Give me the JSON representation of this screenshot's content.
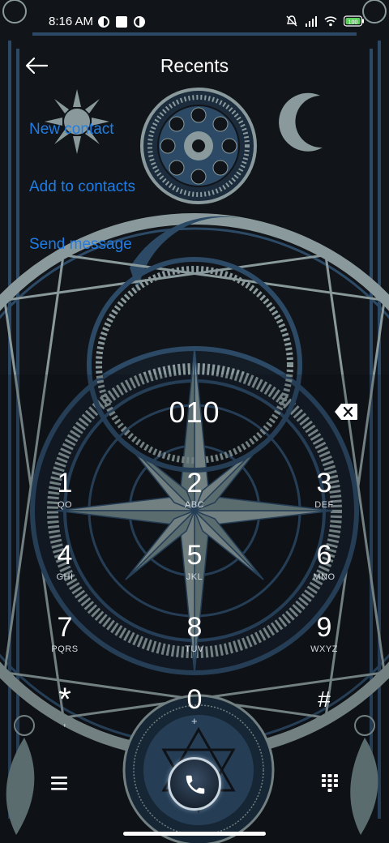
{
  "status": {
    "time": "8:16 AM",
    "battery": "100"
  },
  "header": {
    "title": "Recents"
  },
  "actions": [
    {
      "label": "New contact"
    },
    {
      "label": "Add to contacts"
    },
    {
      "label": "Send message"
    }
  ],
  "dialer": {
    "number": "010",
    "keys": [
      {
        "digit": "1",
        "letters": "QO"
      },
      {
        "digit": "2",
        "letters": "ABC"
      },
      {
        "digit": "3",
        "letters": "DEF"
      },
      {
        "digit": "4",
        "letters": "GHI"
      },
      {
        "digit": "5",
        "letters": "JKL"
      },
      {
        "digit": "6",
        "letters": "MNO"
      },
      {
        "digit": "7",
        "letters": "PQRS"
      },
      {
        "digit": "8",
        "letters": "TUV"
      },
      {
        "digit": "9",
        "letters": "WXYZ"
      },
      {
        "digit": "*",
        "letters": ","
      },
      {
        "digit": "0",
        "letters": "+"
      },
      {
        "digit": "#",
        "letters": ""
      }
    ]
  },
  "colors": {
    "accent": "#1e7de6",
    "background": "#111418",
    "theme_line": "#2c4a66",
    "theme_light": "#8a9a9c"
  },
  "icons": {
    "back": "arrow-left-icon",
    "backspace": "backspace-icon",
    "menu": "menu-icon",
    "call": "phone-icon",
    "dialpad": "dialpad-icon"
  }
}
